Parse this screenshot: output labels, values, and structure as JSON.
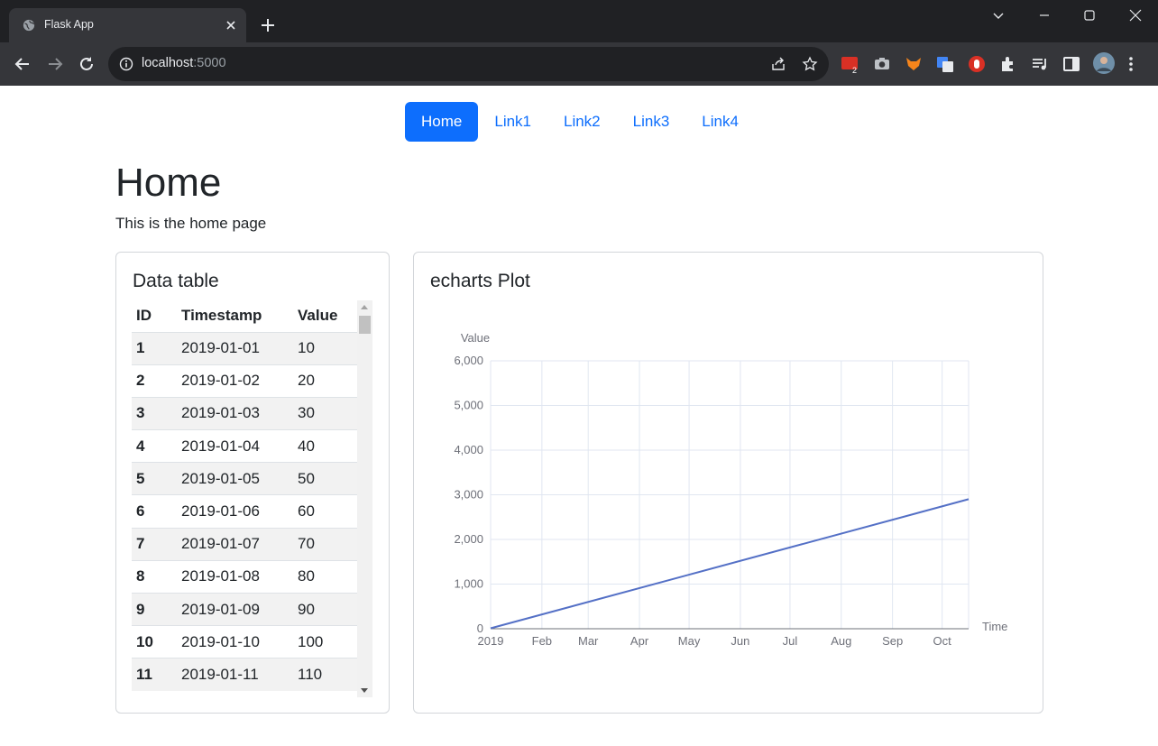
{
  "browser": {
    "tab_title": "Flask App",
    "url_host": "localhost",
    "url_port": ":5000",
    "accent": "#35363a"
  },
  "nav": {
    "items": [
      {
        "label": "Home",
        "active": true
      },
      {
        "label": "Link1",
        "active": false
      },
      {
        "label": "Link2",
        "active": false
      },
      {
        "label": "Link3",
        "active": false
      },
      {
        "label": "Link4",
        "active": false
      }
    ]
  },
  "page": {
    "title": "Home",
    "description": "This is the home page"
  },
  "table_card": {
    "title": "Data table",
    "columns": [
      "ID",
      "Timestamp",
      "Value"
    ],
    "rows": [
      [
        "1",
        "2019-01-01",
        "10"
      ],
      [
        "2",
        "2019-01-02",
        "20"
      ],
      [
        "3",
        "2019-01-03",
        "30"
      ],
      [
        "4",
        "2019-01-04",
        "40"
      ],
      [
        "5",
        "2019-01-05",
        "50"
      ],
      [
        "6",
        "2019-01-06",
        "60"
      ],
      [
        "7",
        "2019-01-07",
        "70"
      ],
      [
        "8",
        "2019-01-08",
        "80"
      ],
      [
        "9",
        "2019-01-09",
        "90"
      ],
      [
        "10",
        "2019-01-10",
        "100"
      ],
      [
        "11",
        "2019-01-11",
        "110"
      ]
    ]
  },
  "chart_card": {
    "title": "echarts Plot"
  },
  "chart_data": {
    "type": "line",
    "title": "",
    "xlabel": "Time",
    "ylabel": "Value",
    "x_tick_labels": [
      "2019",
      "Feb",
      "Mar",
      "Apr",
      "May",
      "Jun",
      "Jul",
      "Aug",
      "Sep",
      "Oct"
    ],
    "y_tick_labels": [
      "0",
      "1,000",
      "2,000",
      "3,000",
      "4,000",
      "5,000",
      "6,000"
    ],
    "ylim": [
      0,
      6000
    ],
    "xlim": [
      "2019-01-01",
      "2019-10-17"
    ],
    "series": [
      {
        "x": [
          "2019-01-01",
          "2019-10-17"
        ],
        "values": [
          10,
          2900
        ]
      }
    ],
    "grid": true,
    "line_color": "#5470c6"
  }
}
